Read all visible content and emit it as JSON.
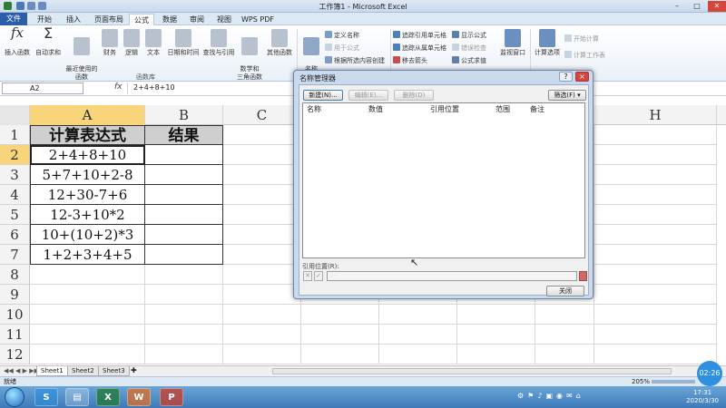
{
  "window": {
    "title": "工作簿1 - Microsoft Excel"
  },
  "tabs": [
    "文件",
    "开始",
    "插入",
    "页面布局",
    "公式",
    "数据",
    "审阅",
    "视图",
    "WPS PDF"
  ],
  "ribbon": {
    "fx_label": "fx",
    "sigma_label": "Σ",
    "function_library": [
      {
        "label": "插入函数"
      },
      {
        "label": "自动求和"
      },
      {
        "label": "最近使用的\n函数"
      },
      {
        "label": "财务"
      },
      {
        "label": "逻辑"
      },
      {
        "label": "文本"
      },
      {
        "label": "日期和时间"
      },
      {
        "label": "查找与引用"
      },
      {
        "label": "数学和\n三角函数"
      },
      {
        "label": "其他函数"
      }
    ],
    "group_function_library": "函数库",
    "name_manager": "名称\n管理器",
    "define_name": "定义名称",
    "use_in_formula": "用于公式",
    "create_from_selection": "根据所选内容创建",
    "trace_precedents": "追踪引用单元格",
    "trace_dependents": "追踪从属单元格",
    "remove_arrows": "移去箭头",
    "show_formulas": "显示公式",
    "error_check": "错误检查",
    "evaluate_formula": "公式求值",
    "watch_window": "监视窗口",
    "calc_options": "计算选项",
    "calc_now": "开始计算",
    "calc_sheet": "计算工作表"
  },
  "formula_bar": {
    "name_box": "A2",
    "fx": "fx",
    "formula": "2+4+8+10"
  },
  "columns": [
    "A",
    "B",
    "C",
    "H"
  ],
  "rows": [
    "1",
    "2",
    "3",
    "4",
    "5",
    "6",
    "7",
    "8",
    "9",
    "10",
    "11",
    "12"
  ],
  "sheet": {
    "header": [
      "计算表达式",
      "结果"
    ],
    "expressions": [
      "2+4+8+10",
      "5+7+10+2-8",
      "12+30-7+6",
      "12-3+10*2",
      "10+(10+2)*3",
      "1+2+3+4+5"
    ]
  },
  "sheet_tabs": [
    "Sheet1",
    "Sheet2",
    "Sheet3"
  ],
  "status": {
    "ready": "就绪",
    "zoom": "205%",
    "video_time": "02:26"
  },
  "dialog": {
    "title": "名称管理器",
    "help": "?",
    "close_x": "×",
    "new": "新建(N)...",
    "edit": "编辑(E)...",
    "delete": "删除(D)",
    "filter": "筛选(F) ▾",
    "columns": [
      "名称",
      "数值",
      "引用位置",
      "范围",
      "备注"
    ],
    "refers_to_label": "引用位置(R):",
    "close": "关闭"
  },
  "taskbar": {
    "time": "17:31",
    "date": "2020/3/30"
  }
}
